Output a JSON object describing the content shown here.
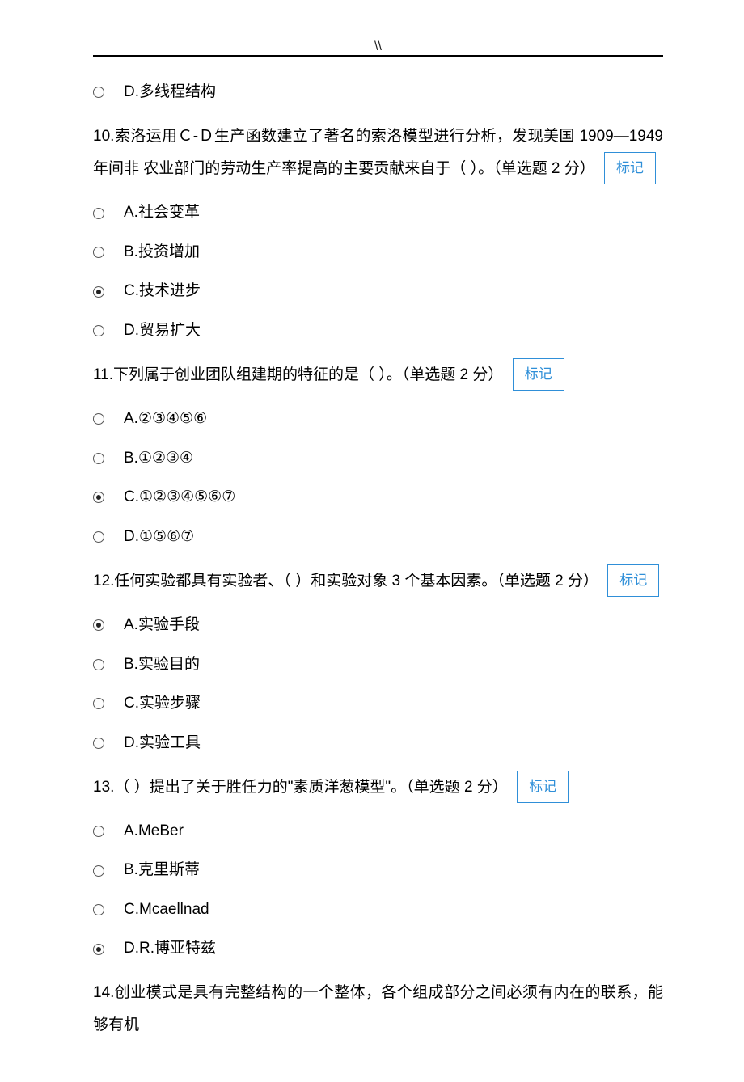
{
  "header": {
    "marks": "\\\\"
  },
  "mark_label": "标记",
  "q9": {
    "options": {
      "D": "D.多线程结构"
    }
  },
  "q10": {
    "stem_a": "10.索洛运用Ｃ‐Ｄ生产函数建立了著名的索洛模型进行分析，发现美国 1909—1949 年间非",
    "stem_b": "农业部门的劳动生产率提高的主要贡献来自于（ ）。（单选题 2 分）",
    "A": "A.社会变革",
    "B": "B.投资增加",
    "C": "C.技术进步",
    "D": "D.贸易扩大"
  },
  "q11": {
    "stem": "11.下列属于创业团队组建期的特征的是（ ）。（单选题 2 分）",
    "A": "A.②③④⑤⑥",
    "B": "B.①②③④",
    "C": "C.①②③④⑤⑥⑦",
    "D": "D.①⑤⑥⑦"
  },
  "q12": {
    "stem": "12.任何实验都具有实验者、（ ）和实验对象 3 个基本因素。（单选题 2 分）",
    "A": "A.实验手段",
    "B": "B.实验目的",
    "C": "C.实验步骤",
    "D": "D.实验工具"
  },
  "q13": {
    "stem": "13.（ ）提出了关于胜任力的\"素质洋葱模型\"。（单选题 2 分）",
    "A": "A.MeBer",
    "B": "B.克里斯蒂",
    "C": "C.Mcaellnad",
    "D": "D.R.博亚特兹"
  },
  "q14": {
    "stem": "14.创业模式是具有完整结构的一个整体，各个组成部分之间必须有内在的联系，能够有机"
  }
}
